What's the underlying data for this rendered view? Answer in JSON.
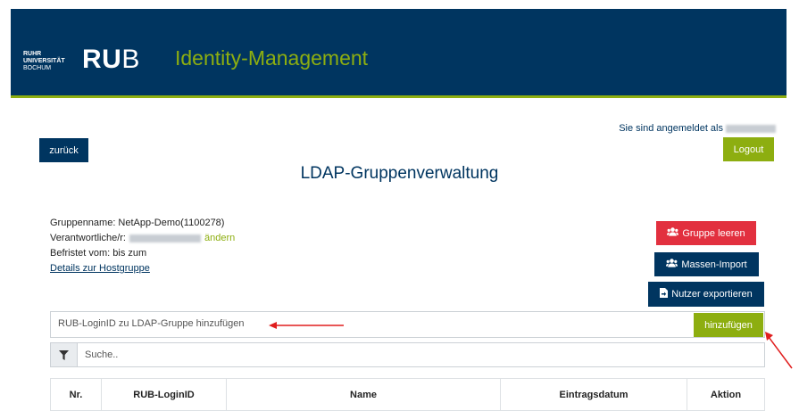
{
  "header": {
    "logo_line1": "RUHR",
    "logo_line2": "UNIVERSITÄT",
    "logo_line3": "BOCHUM",
    "logo_ru": "RU",
    "logo_b": "B",
    "app_title": "Identity-Management"
  },
  "session": {
    "logged_in_label": "Sie sind angemeldet als",
    "logout_label": "Logout"
  },
  "nav": {
    "back_label": "zurück"
  },
  "page_title": "LDAP-Gruppenverwaltung",
  "group": {
    "name_line": "Gruppenname: NetApp-Demo(1100278)",
    "responsible_label": "Verantwortliche/r:",
    "change_label": "ändern",
    "expiry_line": "Befristet vom: bis zum",
    "details_link": "Details zur Hostgruppe"
  },
  "actions": {
    "clear_label": "Gruppe leeren",
    "import_label": "Massen-Import",
    "export_label": "Nutzer exportieren"
  },
  "add": {
    "placeholder": "RUB-LoginID zu LDAP-Gruppe hinzufügen",
    "button_label": "hinzufügen"
  },
  "search": {
    "placeholder": "Suche.."
  },
  "table": {
    "columns": [
      "Nr.",
      "RUB-LoginID",
      "Name",
      "Eintragsdatum",
      "Aktion"
    ]
  },
  "colors": {
    "primary": "#003560",
    "accent": "#8dae10",
    "danger": "#e2303f",
    "annotation": "#e01e1e"
  },
  "icons": {
    "users": "users-icon",
    "file_export": "file-export-icon",
    "filter": "filter-icon"
  }
}
